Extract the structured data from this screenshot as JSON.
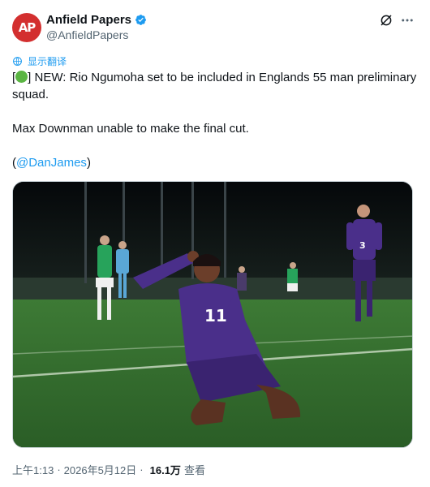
{
  "author": {
    "display_name": "Anfield Papers",
    "handle": "@AnfieldPapers",
    "avatar_text": "AP",
    "verified": true
  },
  "translate_label": "显示翻译",
  "tweet": {
    "line1_open": "[",
    "line1_rest": "] NEW: Rio Ngumoha set to be included in Englands 55 man preliminary squad.",
    "line2": "Max Downman unable to make the final cut.",
    "line3_open": "(",
    "mention": "@DanJames",
    "line3_close": ")"
  },
  "media": {
    "player_number_main": "11",
    "player_number_bg": "3"
  },
  "meta": {
    "time": "上午1:13",
    "date": "2026年5月12日",
    "dot": "·",
    "views_count": "16.1万",
    "views_label": "查看"
  },
  "colors": {
    "accent": "#1d9bf0",
    "avatar": "#d32f2f",
    "kit": "#4a2f8a",
    "pitch": "#2d6a2e"
  },
  "icons": {
    "verified": "verified-badge-icon",
    "grok": "grok-icon",
    "more": "more-options-icon",
    "translate": "globe-icon"
  }
}
